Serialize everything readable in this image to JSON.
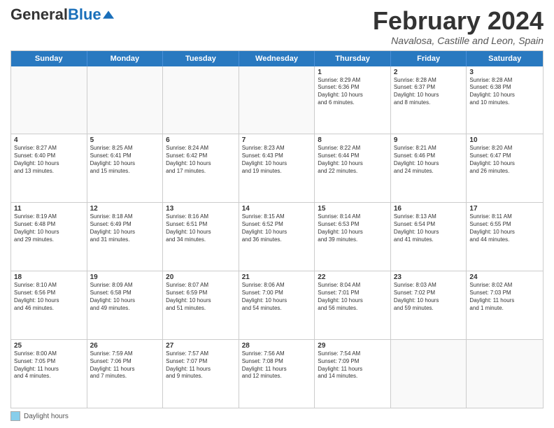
{
  "logo": {
    "general": "General",
    "blue": "Blue"
  },
  "title": "February 2024",
  "location": "Navalosa, Castille and Leon, Spain",
  "days_of_week": [
    "Sunday",
    "Monday",
    "Tuesday",
    "Wednesday",
    "Thursday",
    "Friday",
    "Saturday"
  ],
  "footer": {
    "label": "Daylight hours"
  },
  "weeks": [
    [
      {
        "day": "",
        "info": ""
      },
      {
        "day": "",
        "info": ""
      },
      {
        "day": "",
        "info": ""
      },
      {
        "day": "",
        "info": ""
      },
      {
        "day": "1",
        "info": "Sunrise: 8:29 AM\nSunset: 6:36 PM\nDaylight: 10 hours\nand 6 minutes."
      },
      {
        "day": "2",
        "info": "Sunrise: 8:28 AM\nSunset: 6:37 PM\nDaylight: 10 hours\nand 8 minutes."
      },
      {
        "day": "3",
        "info": "Sunrise: 8:28 AM\nSunset: 6:38 PM\nDaylight: 10 hours\nand 10 minutes."
      }
    ],
    [
      {
        "day": "4",
        "info": "Sunrise: 8:27 AM\nSunset: 6:40 PM\nDaylight: 10 hours\nand 13 minutes."
      },
      {
        "day": "5",
        "info": "Sunrise: 8:25 AM\nSunset: 6:41 PM\nDaylight: 10 hours\nand 15 minutes."
      },
      {
        "day": "6",
        "info": "Sunrise: 8:24 AM\nSunset: 6:42 PM\nDaylight: 10 hours\nand 17 minutes."
      },
      {
        "day": "7",
        "info": "Sunrise: 8:23 AM\nSunset: 6:43 PM\nDaylight: 10 hours\nand 19 minutes."
      },
      {
        "day": "8",
        "info": "Sunrise: 8:22 AM\nSunset: 6:44 PM\nDaylight: 10 hours\nand 22 minutes."
      },
      {
        "day": "9",
        "info": "Sunrise: 8:21 AM\nSunset: 6:46 PM\nDaylight: 10 hours\nand 24 minutes."
      },
      {
        "day": "10",
        "info": "Sunrise: 8:20 AM\nSunset: 6:47 PM\nDaylight: 10 hours\nand 26 minutes."
      }
    ],
    [
      {
        "day": "11",
        "info": "Sunrise: 8:19 AM\nSunset: 6:48 PM\nDaylight: 10 hours\nand 29 minutes."
      },
      {
        "day": "12",
        "info": "Sunrise: 8:18 AM\nSunset: 6:49 PM\nDaylight: 10 hours\nand 31 minutes."
      },
      {
        "day": "13",
        "info": "Sunrise: 8:16 AM\nSunset: 6:51 PM\nDaylight: 10 hours\nand 34 minutes."
      },
      {
        "day": "14",
        "info": "Sunrise: 8:15 AM\nSunset: 6:52 PM\nDaylight: 10 hours\nand 36 minutes."
      },
      {
        "day": "15",
        "info": "Sunrise: 8:14 AM\nSunset: 6:53 PM\nDaylight: 10 hours\nand 39 minutes."
      },
      {
        "day": "16",
        "info": "Sunrise: 8:13 AM\nSunset: 6:54 PM\nDaylight: 10 hours\nand 41 minutes."
      },
      {
        "day": "17",
        "info": "Sunrise: 8:11 AM\nSunset: 6:55 PM\nDaylight: 10 hours\nand 44 minutes."
      }
    ],
    [
      {
        "day": "18",
        "info": "Sunrise: 8:10 AM\nSunset: 6:56 PM\nDaylight: 10 hours\nand 46 minutes."
      },
      {
        "day": "19",
        "info": "Sunrise: 8:09 AM\nSunset: 6:58 PM\nDaylight: 10 hours\nand 49 minutes."
      },
      {
        "day": "20",
        "info": "Sunrise: 8:07 AM\nSunset: 6:59 PM\nDaylight: 10 hours\nand 51 minutes."
      },
      {
        "day": "21",
        "info": "Sunrise: 8:06 AM\nSunset: 7:00 PM\nDaylight: 10 hours\nand 54 minutes."
      },
      {
        "day": "22",
        "info": "Sunrise: 8:04 AM\nSunset: 7:01 PM\nDaylight: 10 hours\nand 56 minutes."
      },
      {
        "day": "23",
        "info": "Sunrise: 8:03 AM\nSunset: 7:02 PM\nDaylight: 10 hours\nand 59 minutes."
      },
      {
        "day": "24",
        "info": "Sunrise: 8:02 AM\nSunset: 7:03 PM\nDaylight: 11 hours\nand 1 minute."
      }
    ],
    [
      {
        "day": "25",
        "info": "Sunrise: 8:00 AM\nSunset: 7:05 PM\nDaylight: 11 hours\nand 4 minutes."
      },
      {
        "day": "26",
        "info": "Sunrise: 7:59 AM\nSunset: 7:06 PM\nDaylight: 11 hours\nand 7 minutes."
      },
      {
        "day": "27",
        "info": "Sunrise: 7:57 AM\nSunset: 7:07 PM\nDaylight: 11 hours\nand 9 minutes."
      },
      {
        "day": "28",
        "info": "Sunrise: 7:56 AM\nSunset: 7:08 PM\nDaylight: 11 hours\nand 12 minutes."
      },
      {
        "day": "29",
        "info": "Sunrise: 7:54 AM\nSunset: 7:09 PM\nDaylight: 11 hours\nand 14 minutes."
      },
      {
        "day": "",
        "info": ""
      },
      {
        "day": "",
        "info": ""
      }
    ]
  ]
}
